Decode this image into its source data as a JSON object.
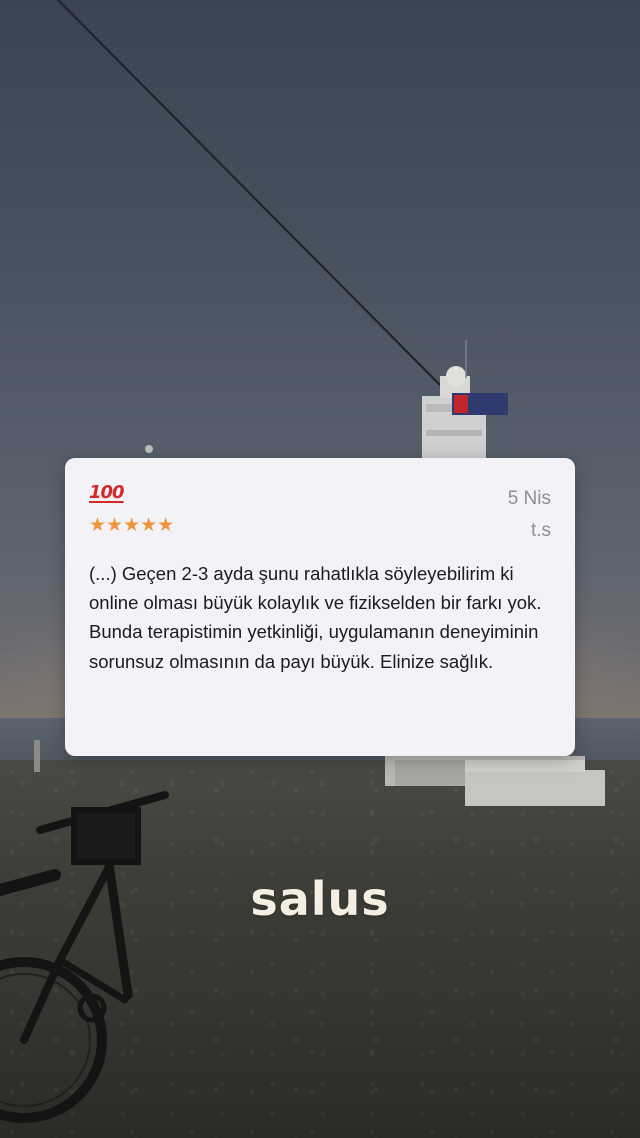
{
  "background": {
    "description_icon": "lighthouse-dusk-photo"
  },
  "review": {
    "badge_emoji": "💯",
    "badge_text": "100",
    "stars": "★★★★★",
    "rating": 5,
    "date": "5 Nis",
    "author": "t.s",
    "text": "(...) Geçen 2-3 ayda şunu rahatlıkla söyleyebilirim ki online olması büyük kolaylık ve fizikselden bir farkı yok. Bunda terapistimin yetkinliği, uygulamanın deneyiminin sorunsuz olmasının da payı büyük. Elinize sağlık.",
    "colors": {
      "card_bg": "#f2f2f7",
      "star": "#f0963a",
      "badge": "#d42a2a",
      "meta": "#8e8e93",
      "body": "#1c1c1e"
    }
  },
  "brand": {
    "name": "salus",
    "color": "#f4efe2"
  }
}
